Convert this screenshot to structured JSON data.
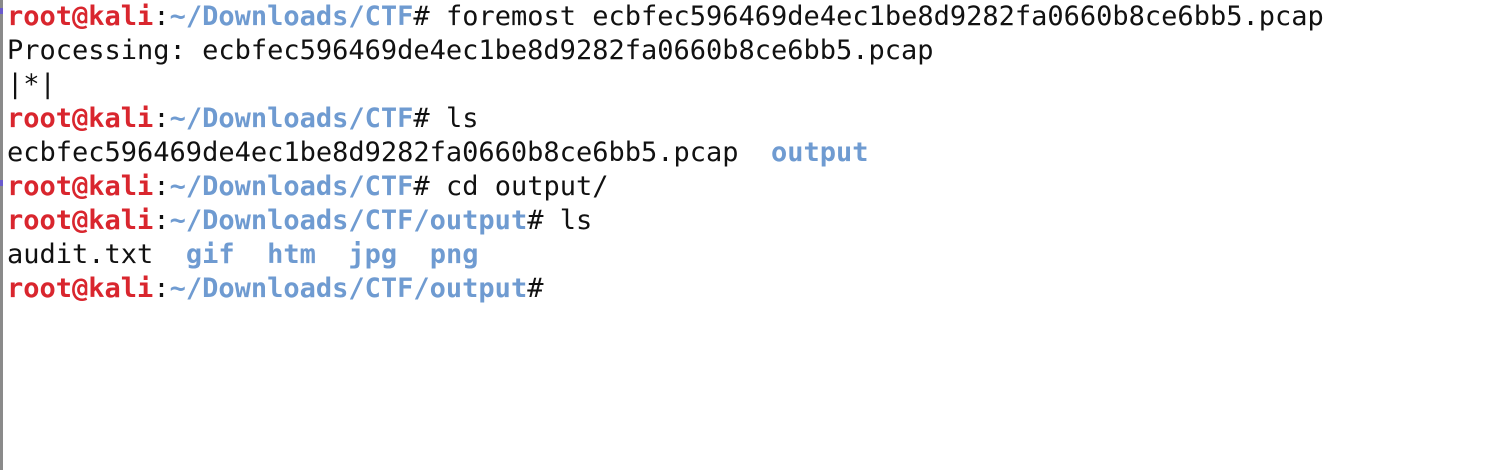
{
  "terminal": {
    "colors": {
      "user": "#d9262e",
      "path": "#6f9bd1",
      "text": "#111111",
      "background": "#ffffff"
    },
    "lines": [
      {
        "type": "prompt",
        "user": "root@kali",
        "sep": ":",
        "path": "~/Downloads/CTF",
        "hash": "#",
        "command": " foremost ecbfec596469de4ec1be8d9282fa0660b8ce6bb5.pcap"
      },
      {
        "type": "output",
        "text": "Processing: ecbfec596469de4ec1be8d9282fa0660b8ce6bb5.pcap"
      },
      {
        "type": "output",
        "text": "|*|"
      },
      {
        "type": "prompt",
        "user": "root@kali",
        "sep": ":",
        "path": "~/Downloads/CTF",
        "hash": "#",
        "command": " ls"
      },
      {
        "type": "listing",
        "entries": [
          {
            "name": "ecbfec596469de4ec1be8d9282fa0660b8ce6bb5.pcap",
            "kind": "file"
          },
          {
            "name": "output",
            "kind": "dir"
          }
        ]
      },
      {
        "type": "prompt",
        "user": "root@kali",
        "sep": ":",
        "path": "~/Downloads/CTF",
        "hash": "#",
        "command": " cd output/"
      },
      {
        "type": "prompt",
        "user": "root@kali",
        "sep": ":",
        "path": "~/Downloads/CTF/output",
        "hash": "#",
        "command": " ls"
      },
      {
        "type": "listing",
        "entries": [
          {
            "name": "audit.txt",
            "kind": "file"
          },
          {
            "name": "gif",
            "kind": "dir"
          },
          {
            "name": "htm",
            "kind": "dir"
          },
          {
            "name": "jpg",
            "kind": "dir"
          },
          {
            "name": "png",
            "kind": "dir"
          }
        ]
      },
      {
        "type": "prompt",
        "user": "root@kali",
        "sep": ":",
        "path": "~/Downloads/CTF/output",
        "hash": "#",
        "command": ""
      }
    ]
  }
}
